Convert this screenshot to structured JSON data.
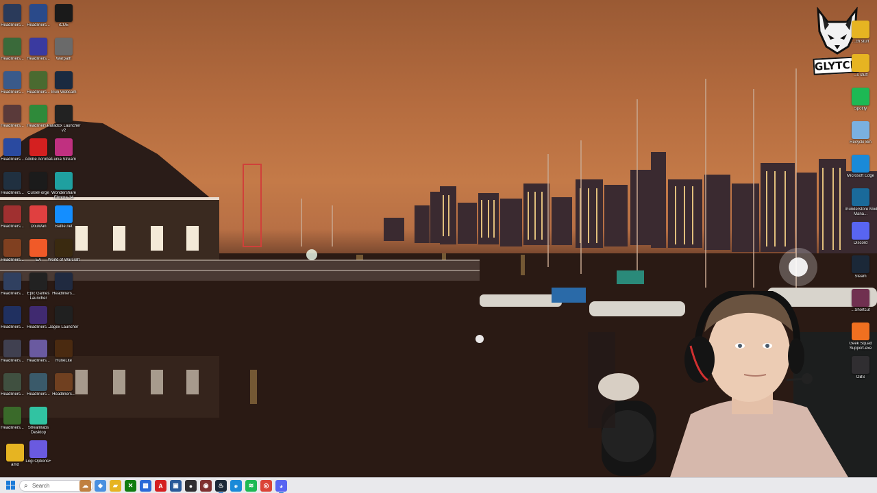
{
  "desktop": {
    "left_column": [
      {
        "label": "Headliners...",
        "name": "headliners-icon",
        "color": "#2a3a5a"
      },
      {
        "label": "Headliners...",
        "name": "headliners-icon",
        "color": "#3a6a3a"
      },
      {
        "label": "Headliners...",
        "name": "headliners-icon",
        "color": "#3a5a8a"
      },
      {
        "label": "Headliners...",
        "name": "headliners-icon",
        "color": "#5a3a3a"
      },
      {
        "label": "Headliners...",
        "name": "headliners-icon",
        "color": "#2a4aa0"
      },
      {
        "label": "Headliners...",
        "name": "headliners-icon",
        "color": "#203040"
      },
      {
        "label": "Headliners...",
        "name": "headliners-icon",
        "color": "#a03030"
      },
      {
        "label": "Headliners...",
        "name": "headliners-icon",
        "color": "#804020"
      },
      {
        "label": "Headliners...",
        "name": "headliners-icon",
        "color": "#304060"
      },
      {
        "label": "Headliners...",
        "name": "headliners-icon",
        "color": "#203060"
      },
      {
        "label": "Headliners...",
        "name": "headliners-icon",
        "color": "#404050"
      },
      {
        "label": "Headliners...",
        "name": "headliners-icon",
        "color": "#405040"
      },
      {
        "label": "Headliners...",
        "name": "headliners-icon",
        "color": "#3a6a2a"
      }
    ],
    "middle_column": [
      {
        "label": "Headliners...",
        "name": "headliners-icon",
        "color": "#2a4a8a"
      },
      {
        "label": "Headliners...",
        "name": "headliners-icon",
        "color": "#3a3aa0"
      },
      {
        "label": "Headliners...",
        "name": "headliners-icon",
        "color": "#4a6a30"
      },
      {
        "label": "Headliners...",
        "name": "headliners-icon",
        "color": "#2f8a3a"
      },
      {
        "label": "Adobe Acrobat",
        "name": "adobe-acrobat-icon",
        "color": "#d42020"
      },
      {
        "label": "CurseForge",
        "name": "curseforge-icon",
        "color": "#1b1b1b"
      },
      {
        "label": "DouWan",
        "name": "douwan-icon",
        "color": "#e04040"
      },
      {
        "label": "EA",
        "name": "ea-icon",
        "color": "#f05a28"
      },
      {
        "label": "Epic Games Launcher",
        "name": "epic-games-icon",
        "color": "#222222"
      },
      {
        "label": "Headliners...",
        "name": "headliners-icon",
        "color": "#402a70"
      },
      {
        "label": "Headliners...",
        "name": "headliners-icon",
        "color": "#6a5aa0"
      },
      {
        "label": "Headliners...",
        "name": "headliners-icon",
        "color": "#3a5a6a"
      },
      {
        "label": "Streamlabs Desktop",
        "name": "streamlabs-icon",
        "color": "#31c3a2"
      },
      {
        "label": "Logi Options+",
        "name": "logi-options-icon",
        "color": "#6a5ae0"
      }
    ],
    "right_column": [
      {
        "label": "iCUE",
        "name": "icue-icon",
        "color": "#1a1a1a"
      },
      {
        "label": "Warpath",
        "name": "warpath-icon",
        "color": "#6a6a6a"
      },
      {
        "label": "Iriun Webcam",
        "name": "iriun-webcam-icon",
        "color": "#1a2a40"
      },
      {
        "label": "Paradox Launcher v2",
        "name": "paradox-launcher-icon",
        "color": "#222222"
      },
      {
        "label": "Lunia Stream",
        "name": "lunia-stream-icon",
        "color": "#c03080"
      },
      {
        "label": "Wondershare Filmora 14",
        "name": "filmora-icon",
        "color": "#1fa0a0"
      },
      {
        "label": "Battle.net",
        "name": "battle-net-icon",
        "color": "#148eff"
      },
      {
        "label": "World of Warcraft",
        "name": "world-of-warcraft-icon",
        "color": "#3a2a10"
      },
      {
        "label": "Headliners...",
        "name": "headliners-icon",
        "color": "#202a40"
      },
      {
        "label": "Jagex Launcher",
        "name": "jagex-launcher-icon",
        "color": "#202020"
      },
      {
        "label": "RuneLite",
        "name": "runelite-icon",
        "color": "#4a2a10"
      },
      {
        "label": "Headliners...",
        "name": "headliners-icon",
        "color": "#704020"
      }
    ],
    "bottom_left": {
      "label": "amd",
      "name": "amd-folder-icon",
      "color": "#e6b422"
    },
    "right_edge": [
      {
        "label": "...ch stuff",
        "name": "folder-icon",
        "color": "#e6b422"
      },
      {
        "label": "...s stuff",
        "name": "folder-icon",
        "color": "#e6b422"
      },
      {
        "label": "Spotify",
        "name": "spotify-icon",
        "color": "#1db954"
      },
      {
        "label": "Recycle Bin",
        "name": "recycle-bin-icon",
        "color": "#7ab0e0"
      },
      {
        "label": "Microsoft Edge",
        "name": "microsoft-edge-icon",
        "color": "#1a8ad8"
      },
      {
        "label": "Thunderstore Mod Mana...",
        "name": "thunderstore-icon",
        "color": "#1a6a9a"
      },
      {
        "label": "Discord",
        "name": "discord-icon",
        "color": "#5865f2"
      },
      {
        "label": "Steam",
        "name": "steam-icon",
        "color": "#1b2838"
      },
      {
        "label": "...Shortcut",
        "name": "shortcut-icon",
        "color": "#703050"
      },
      {
        "label": "Geek Squad Support.exe",
        "name": "geek-squad-icon",
        "color": "#f07020"
      },
      {
        "label": "OBS",
        "name": "obs-icon",
        "color": "#302e31"
      }
    ]
  },
  "overlay": {
    "logo_text": "GLYTCH"
  },
  "taskbar": {
    "search_placeholder": "Search",
    "apps": [
      {
        "name": "widgets-icon",
        "color": "#c08040",
        "glyph": "☁"
      },
      {
        "name": "copilot-icon",
        "color": "#4a90e0",
        "glyph": "◆"
      },
      {
        "name": "file-explorer-icon",
        "color": "#e6b422",
        "glyph": "▰"
      },
      {
        "name": "xbox-icon",
        "color": "#107c10",
        "glyph": "✕"
      },
      {
        "name": "microsoft-store-icon",
        "color": "#2a6ad8",
        "glyph": "▦"
      },
      {
        "name": "adobe-icon",
        "color": "#d42020",
        "glyph": "A"
      },
      {
        "name": "app-icon",
        "color": "#2a5a9a",
        "glyph": "▣"
      },
      {
        "name": "obs-icon",
        "color": "#302e31",
        "glyph": "●"
      },
      {
        "name": "game-icon",
        "color": "#803030",
        "glyph": "◉"
      },
      {
        "name": "steam-icon",
        "color": "#1b2838",
        "glyph": "♨",
        "active": true
      },
      {
        "name": "edge-icon",
        "color": "#1a8ad8",
        "glyph": "e"
      },
      {
        "name": "spotify-icon",
        "color": "#1db954",
        "glyph": "≋"
      },
      {
        "name": "chrome-icon",
        "color": "#db4437",
        "glyph": "◎"
      },
      {
        "name": "discord-icon",
        "color": "#5865f2",
        "glyph": "◕",
        "active": true
      }
    ]
  }
}
